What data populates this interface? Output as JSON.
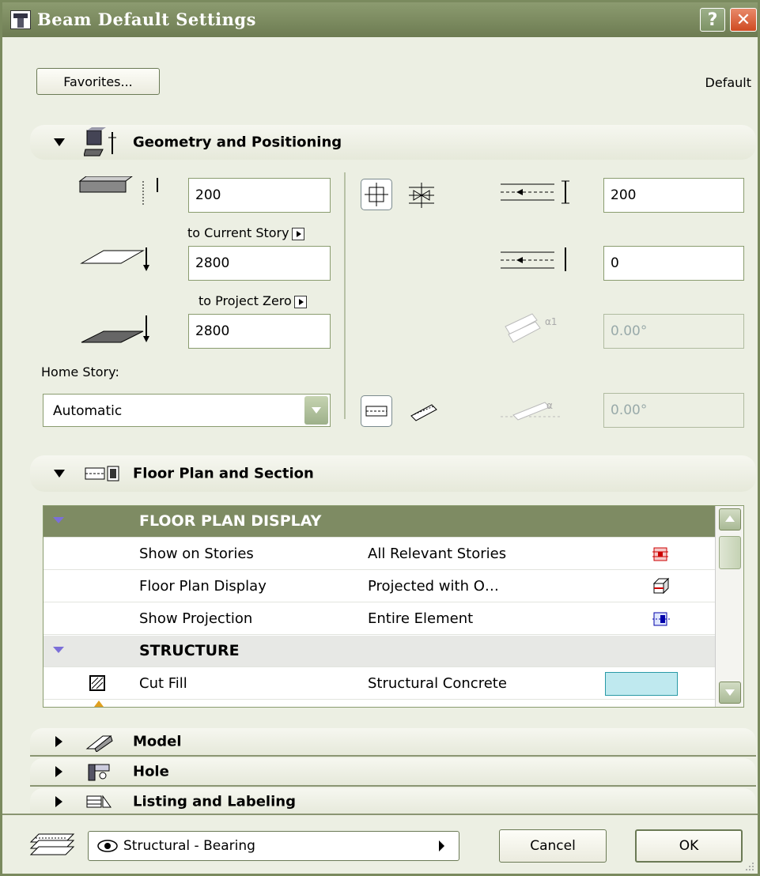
{
  "window": {
    "title": "Beam Default Settings",
    "help_glyph": "?",
    "close_glyph": "✕"
  },
  "toolbar": {
    "favorites_label": "Favorites...",
    "default_label": "Default"
  },
  "geometry": {
    "title": "Geometry and Positioning",
    "height_value": "200",
    "to_current_story_label": "to Current Story",
    "current_story_offset": "2800",
    "to_project_zero_label": "to Project Zero",
    "project_zero_offset": "2800",
    "home_story_label": "Home Story:",
    "home_story_value": "Automatic",
    "width_value": "200",
    "offset_value": "0",
    "slant_angle": "0.00°",
    "incline_angle": "0.00°"
  },
  "floorplan": {
    "title": "Floor Plan and Section",
    "groups": [
      {
        "name": "FLOOR PLAN DISPLAY"
      },
      {
        "name": "STRUCTURE"
      }
    ],
    "rows": [
      {
        "label": "Show on Stories",
        "value": "All Relevant Stories",
        "icon": "stories-icon"
      },
      {
        "label": "Floor Plan Display",
        "value": "Projected with O…",
        "icon": "projected-icon"
      },
      {
        "label": "Show Projection",
        "value": "Entire Element",
        "icon": "projection-icon"
      },
      {
        "label": "Cut Fill",
        "value": "Structural Concrete",
        "icon": "fill-pattern-icon"
      }
    ]
  },
  "sections": {
    "model": "Model",
    "hole": "Hole",
    "listing": "Listing and Labeling"
  },
  "footer": {
    "layer_value": "Structural - Bearing",
    "cancel_label": "Cancel",
    "ok_label": "OK"
  },
  "colors": {
    "titlebar": "#7b8a5f",
    "accent_dark": "#7e8b63",
    "structure_fill": "#bfe9ef"
  }
}
